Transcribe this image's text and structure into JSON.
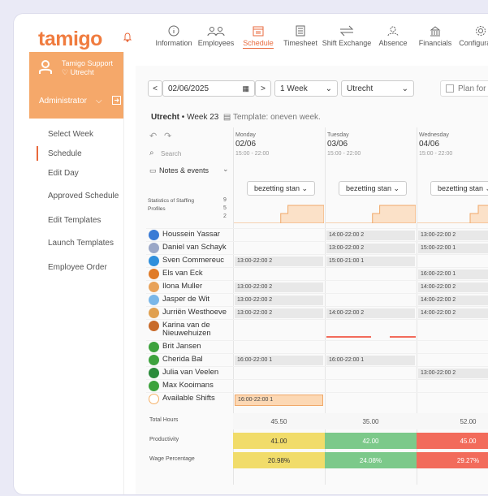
{
  "app": {
    "logo": "tamigo"
  },
  "nav": [
    {
      "label": "Information",
      "icon": "info-icon",
      "active": false
    },
    {
      "label": "Employees",
      "icon": "employees-icon",
      "active": false
    },
    {
      "label": "Schedule",
      "icon": "schedule-icon",
      "active": true
    },
    {
      "label": "Timesheet",
      "icon": "timesheet-icon",
      "active": false
    },
    {
      "label": "Shift Exchange",
      "icon": "shift-exchange-icon",
      "active": false
    },
    {
      "label": "Absence",
      "icon": "absence-icon",
      "active": false
    },
    {
      "label": "Financials",
      "icon": "financials-icon",
      "active": false
    },
    {
      "label": "Configuration",
      "icon": "configuration-icon",
      "active": false
    }
  ],
  "user": {
    "name": "Tamigo Support",
    "location": "♡ Utrecht",
    "role": "Administrator"
  },
  "sidebar": {
    "items": [
      {
        "label": "Select Week",
        "active": false
      },
      {
        "label": "Schedule",
        "active": true
      },
      {
        "label": "Edit Day",
        "active": false
      },
      {
        "label": "Approved Schedule",
        "active": false
      },
      {
        "label": "Edit Templates",
        "active": false
      },
      {
        "label": "Launch Templates",
        "active": false
      },
      {
        "label": "Employee Order",
        "active": false
      }
    ]
  },
  "toolbar": {
    "prev": "<",
    "date": "02/06/2025",
    "next": ">",
    "period": "1 Week",
    "location": "Utrecht",
    "plan_label": "Plan for multip"
  },
  "week": {
    "location": "Utrecht",
    "week_label": "• Week 23",
    "template": "Template: oneven week."
  },
  "grid": {
    "search_placeholder": "Search",
    "notes_label": "Notes & events",
    "staffing_label": "Statistics of Staffing Profiles",
    "staffing_ticks": [
      "9",
      "5",
      "2"
    ],
    "bezetting": "bezetting stan",
    "days": [
      {
        "name": "Monday",
        "date": "02/06",
        "hours": "15:00 - 22:00"
      },
      {
        "name": "Tuesday",
        "date": "03/06",
        "hours": "15:00 - 22:00"
      },
      {
        "name": "Wednesday",
        "date": "04/06",
        "hours": "15:00 - 22:00"
      }
    ],
    "employees": [
      {
        "name": "Houssein Yassar",
        "color": "#3a7bd5",
        "shifts": [
          "",
          "14:00-22:00 2",
          "13:00-22:00 2"
        ]
      },
      {
        "name": "Daniel van Schayk",
        "color": "#9aa7c7",
        "shifts": [
          "",
          "13:00-22:00 2",
          "15:00-22:00 1"
        ]
      },
      {
        "name": "Sven Commereuc",
        "color": "#2f8fdc",
        "shifts": [
          "13:00-22:00 2",
          "15:00-21:00 1",
          ""
        ]
      },
      {
        "name": "Els van Eck",
        "color": "#e07b28",
        "shifts": [
          "",
          "",
          "16:00-22:00 1"
        ]
      },
      {
        "name": "Ilona Muller",
        "color": "#e8a25a",
        "shifts": [
          "13:00-22:00 2",
          "",
          "14:00-22:00 2"
        ]
      },
      {
        "name": "Jasper de Wit",
        "color": "#7ab7e8",
        "shifts": [
          "13:00-22:00 2",
          "",
          "14:00-22:00 2"
        ]
      },
      {
        "name": "Jurriën Westhoeve",
        "color": "#e0a050",
        "shifts": [
          "13:00-22:00 2",
          "14:00-22:00 2",
          "14:00-22:00 2"
        ]
      },
      {
        "name": "Karina van de Nieuwehuizen",
        "color": "#c86a2a",
        "shifts": [
          "",
          "",
          ""
        ]
      },
      {
        "name": "Brit Jansen",
        "color": "#3da23d",
        "shifts": [
          "",
          "",
          ""
        ]
      },
      {
        "name": "Cherida Bal",
        "color": "#3da23d",
        "shifts": [
          "16:00-22:00 1",
          "16:00-22:00 1",
          ""
        ]
      },
      {
        "name": "Julia van Veelen",
        "color": "#2b8a3b",
        "shifts": [
          "",
          "",
          "13:00-22:00 2"
        ]
      },
      {
        "name": "Max Kooimans",
        "color": "#3da23d",
        "shifts": [
          "",
          "",
          ""
        ]
      },
      {
        "name": "Available Shifts",
        "color": "#f5b067",
        "shifts": [
          "16:00-22:00 1",
          "",
          ""
        ]
      }
    ],
    "totals": [
      {
        "label": "Total Hours",
        "values": [
          "45.50",
          "35.00",
          "52.00"
        ],
        "colors": [
          "#f7f7f7",
          "#f7f7f7",
          "#f7f7f7"
        ]
      },
      {
        "label": "Productivity",
        "values": [
          "41.00",
          "42.00",
          "45.00"
        ],
        "colors": [
          "#f1dc6a",
          "#7cc98a",
          "#f26b5b"
        ]
      },
      {
        "label": "Wage Percentage",
        "values": [
          "20.98%",
          "24.08%",
          "29.27%"
        ],
        "colors": [
          "#f1dc6a",
          "#7cc98a",
          "#f26b5b"
        ]
      }
    ]
  }
}
